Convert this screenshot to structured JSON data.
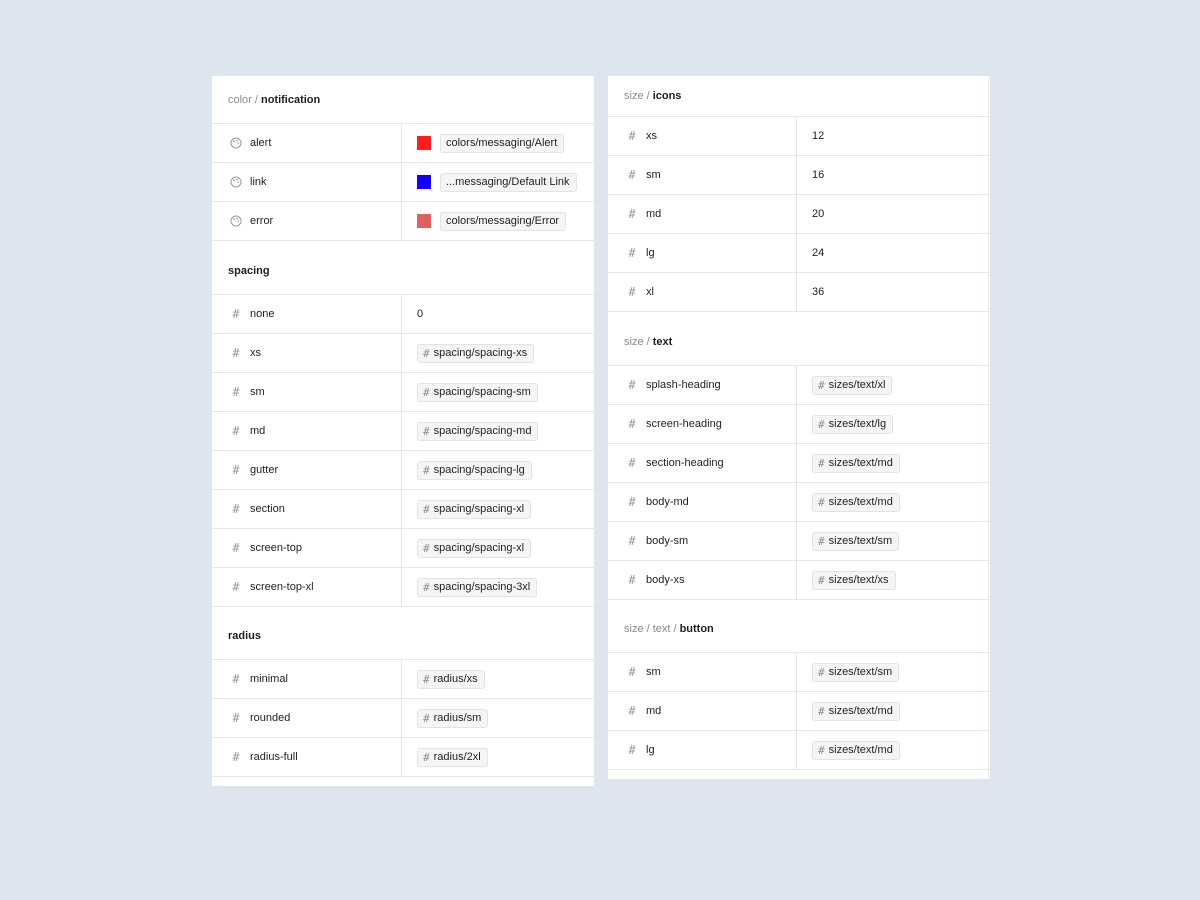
{
  "left": {
    "notification": {
      "path": "color / ",
      "name": "notification",
      "rows": [
        {
          "label": "alert",
          "value": "colors/messaging/Alert",
          "swatch": "#ff1f1f"
        },
        {
          "label": "link",
          "value": "...messaging/Default Link",
          "swatch": "#1400ff"
        },
        {
          "label": "error",
          "value": "colors/messaging/Error",
          "swatch": "#e06060"
        }
      ]
    },
    "spacing": {
      "name": "spacing",
      "rows": [
        {
          "label": "none",
          "value": "0"
        },
        {
          "label": "xs",
          "value": "spacing/spacing-xs"
        },
        {
          "label": "sm",
          "value": "spacing/spacing-sm"
        },
        {
          "label": "md",
          "value": "spacing/spacing-md"
        },
        {
          "label": "gutter",
          "value": "spacing/spacing-lg"
        },
        {
          "label": "section",
          "value": "spacing/spacing-xl"
        },
        {
          "label": "screen-top",
          "value": "spacing/spacing-xl"
        },
        {
          "label": "screen-top-xl",
          "value": "spacing/spacing-3xl"
        }
      ]
    },
    "radius": {
      "name": "radius",
      "rows": [
        {
          "label": "minimal",
          "value": "radius/xs"
        },
        {
          "label": "rounded",
          "value": "radius/sm"
        },
        {
          "label": "radius-full",
          "value": "radius/2xl"
        }
      ]
    }
  },
  "right": {
    "icons": {
      "path": "size / ",
      "name": "icons",
      "rows": [
        {
          "label": "xs",
          "value": "12"
        },
        {
          "label": "sm",
          "value": "16"
        },
        {
          "label": "md",
          "value": "20"
        },
        {
          "label": "lg",
          "value": "24"
        },
        {
          "label": "xl",
          "value": "36"
        }
      ]
    },
    "text": {
      "path": "size / ",
      "name": "text",
      "rows": [
        {
          "label": "splash-heading",
          "value": "sizes/text/xl"
        },
        {
          "label": "screen-heading",
          "value": "sizes/text/lg"
        },
        {
          "label": "section-heading",
          "value": "sizes/text/md"
        },
        {
          "label": "body-md",
          "value": "sizes/text/md"
        },
        {
          "label": "body-sm",
          "value": "sizes/text/sm"
        },
        {
          "label": "body-xs",
          "value": "sizes/text/xs"
        }
      ]
    },
    "button": {
      "path": "size / text / ",
      "name": "button",
      "rows": [
        {
          "label": "sm",
          "value": "sizes/text/sm"
        },
        {
          "label": "md",
          "value": "sizes/text/md"
        },
        {
          "label": "lg",
          "value": "sizes/text/md"
        }
      ]
    }
  },
  "icons": {
    "hash": "#",
    "palette": "palette-icon"
  }
}
